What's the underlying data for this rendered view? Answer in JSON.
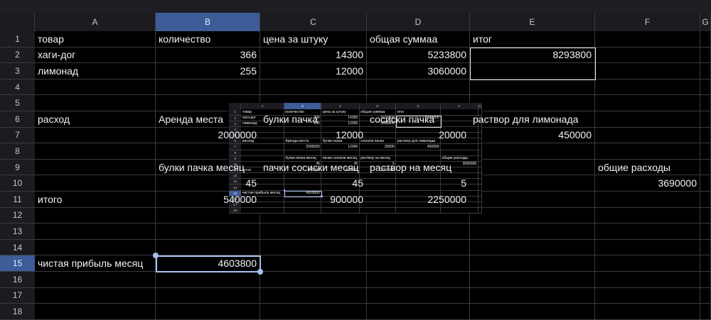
{
  "sheet": {
    "columns": [
      "A",
      "B",
      "C",
      "D",
      "E",
      "F",
      "G"
    ],
    "selected_column": "B",
    "selected_row": 15,
    "selected_cell": "B15",
    "row_count": 18,
    "cells": {
      "A1": "товар",
      "B1": "количество",
      "C1": "цена за штуку",
      "D1": "общая суммаа",
      "E1": "итог",
      "A2": "хаги-дог",
      "B2": "366",
      "C2": "14300",
      "D2": "5233800",
      "E2": "8293800",
      "A3": "лимонад",
      "B3": "255",
      "C3": "12000",
      "D3": "3060000",
      "A6": "расход",
      "B6": "Аренда места",
      "C6": "булки пачка",
      "D6": "сосиски пачка",
      "E6": "раствор для лимонада",
      "B7": "2000000",
      "C7": "12000",
      "D7": "20000",
      "E7": "450000",
      "B9": "булки пачка месяц",
      "C9": "пачки сосиски месяц",
      "D9": "раствор на месяц",
      "F9": "общие расходы",
      "B10": "45",
      "C10": "45",
      "D10": "5",
      "F10": "3690000",
      "A11": "итого",
      "B11": "540000",
      "C11": "900000",
      "D11": "2250000",
      "A15": "чистая прибыль  месяц",
      "B15": "4603800"
    }
  },
  "colors": {
    "accent": "#3d5c98",
    "selection": "#aac0f0"
  }
}
